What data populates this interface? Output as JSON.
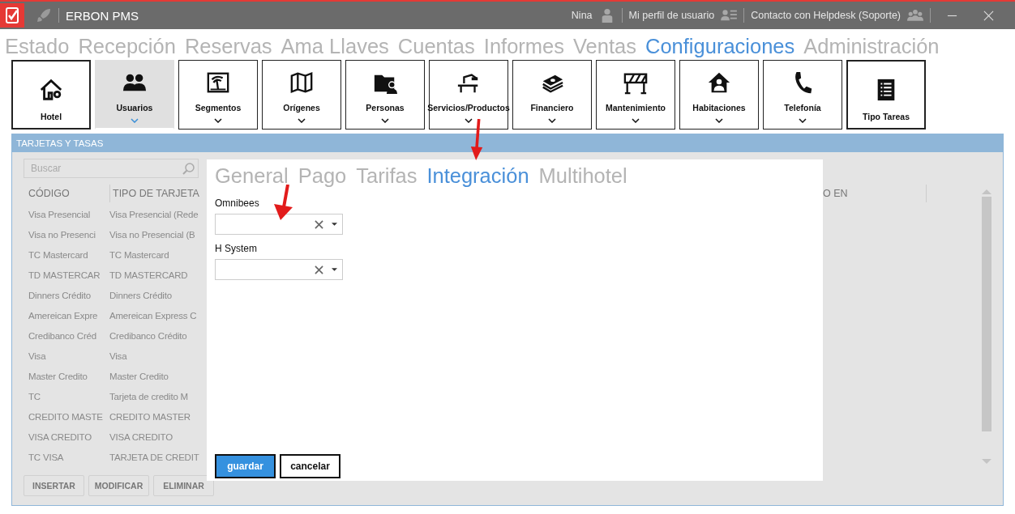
{
  "window": {
    "title": "ERBON PMS",
    "user": "Nina",
    "profile": "Mi perfil de usuario",
    "helpdesk": "Contacto con Helpdesk (Soporte)"
  },
  "main_menu": [
    {
      "label": "Estado",
      "selected": false
    },
    {
      "label": "Recepción",
      "selected": false
    },
    {
      "label": "Reservas",
      "selected": false
    },
    {
      "label": "Ama Llaves",
      "selected": false
    },
    {
      "label": "Cuentas",
      "selected": false
    },
    {
      "label": "Informes",
      "selected": false
    },
    {
      "label": "Ventas",
      "selected": false
    },
    {
      "label": "Configuraciones",
      "selected": true
    },
    {
      "label": "Administración",
      "selected": false
    }
  ],
  "toolbar": [
    {
      "label": "Hotel",
      "kind": "plain",
      "selected": false
    },
    {
      "label": "Usuarios",
      "kind": "dropdown",
      "selected": true
    },
    {
      "label": "Segmentos",
      "kind": "dropdown",
      "selected": false
    },
    {
      "label": "Orígenes",
      "kind": "dropdown",
      "selected": false
    },
    {
      "label": "Personas",
      "kind": "dropdown",
      "selected": false
    },
    {
      "label": "Servicios/Productos",
      "kind": "dropdown",
      "selected": false
    },
    {
      "label": "Financiero",
      "kind": "dropdown",
      "selected": false
    },
    {
      "label": "Mantenimiento",
      "kind": "dropdown",
      "selected": false
    },
    {
      "label": "Habitaciones",
      "kind": "dropdown",
      "selected": false
    },
    {
      "label": "Telefonía",
      "kind": "dropdown",
      "selected": false
    },
    {
      "label": "Tipo Tareas",
      "kind": "plain",
      "selected": false
    }
  ],
  "panel": {
    "title": "TARJETAS Y TASAS",
    "search": {
      "placeholder": "Buscar"
    },
    "table": {
      "columns": [
        "CÓDIGO",
        "TIPO DE TARJETA",
        "O EN"
      ],
      "rows": [
        [
          "Visa Presencial",
          "Visa Presencial (Rede"
        ],
        [
          "Visa no Presenci",
          "Visa no Presencial (B"
        ],
        [
          "TC Mastercard",
          "TC Mastercard"
        ],
        [
          "TD MASTERCAR",
          "TD MASTERCARD"
        ],
        [
          "Dinners Crédito",
          "Dinners Crédito"
        ],
        [
          "Amereican Expre",
          "Amereican Express C"
        ],
        [
          "Credibanco Créd",
          "Credibanco Crédito"
        ],
        [
          "Visa",
          "Visa"
        ],
        [
          "Master Credito",
          "Master Credito"
        ],
        [
          "TC",
          "Tarjeta de credito M"
        ],
        [
          "CREDITO MASTE",
          "CREDITO MASTER"
        ],
        [
          "VISA CREDITO",
          "VISA CREDITO"
        ],
        [
          "TC VISA",
          "TARJETA DE CREDIT"
        ]
      ]
    },
    "buttons": [
      "INSERTAR",
      "MODIFICAR",
      "ELIMINAR"
    ]
  },
  "dialog": {
    "tabs": [
      {
        "label": "General",
        "selected": false
      },
      {
        "label": "Pago",
        "selected": false
      },
      {
        "label": "Tarifas",
        "selected": false
      },
      {
        "label": "Integración",
        "selected": true
      },
      {
        "label": "Multihotel",
        "selected": false
      }
    ],
    "fields": [
      {
        "label": "Omnibees"
      },
      {
        "label": "H System"
      }
    ],
    "buttons": [
      {
        "label": "guardar",
        "kind": "primary"
      },
      {
        "label": "cancelar",
        "kind": "secondary"
      }
    ]
  }
}
